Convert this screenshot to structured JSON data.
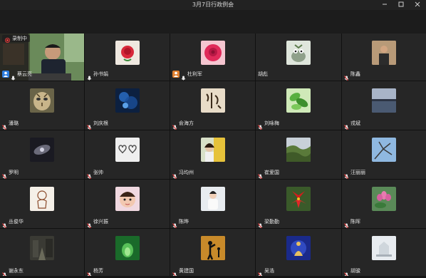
{
  "window": {
    "title": "3月7日行政例会",
    "minimize_icon": "minimize-icon",
    "maximize_icon": "maximize-icon",
    "close_icon": "close-icon"
  },
  "recording": {
    "label": "录制中"
  },
  "participants": [
    {
      "name": "蔡云亮",
      "mic": "on",
      "badge": "host",
      "badge_color": "#2f7fe0",
      "video": true
    },
    {
      "name": "孙书娟",
      "mic": "on",
      "avatar": "red-rose"
    },
    {
      "name": "杜利军",
      "mic": "on",
      "badge": "cohost",
      "badge_color": "#e08030",
      "avatar": "pink-rose"
    },
    {
      "name": "胡彪",
      "mic": "none",
      "avatar": "cartoon-pot"
    },
    {
      "name": "陈鑫",
      "mic": "off",
      "avatar": "man-portrait"
    },
    {
      "name": "潘璐",
      "mic": "off",
      "avatar": "tiger-face"
    },
    {
      "name": "刘庆根",
      "mic": "off",
      "avatar": "blue-water"
    },
    {
      "name": "俞海方",
      "mic": "off",
      "avatar": "calligraphy"
    },
    {
      "name": "刘咏梅",
      "mic": "off",
      "avatar": "green-leaves"
    },
    {
      "name": "戎斌",
      "mic": "off",
      "avatar": "lake-sunset"
    },
    {
      "name": "罗明",
      "mic": "off",
      "avatar": "galaxy"
    },
    {
      "name": "张帅",
      "mic": "off",
      "avatar": "hearts"
    },
    {
      "name": "冯均州",
      "mic": "off",
      "avatar": "woman-flowers"
    },
    {
      "name": "崔爱国",
      "mic": "off",
      "avatar": "valley"
    },
    {
      "name": "汪丽丽",
      "mic": "off",
      "avatar": "branches-sky"
    },
    {
      "name": "丛俊华",
      "mic": "off",
      "avatar": "sketch-figure"
    },
    {
      "name": "徐兴振",
      "mic": "off",
      "avatar": "child-face"
    },
    {
      "name": "陈晔",
      "mic": "off",
      "avatar": "girl-white"
    },
    {
      "name": "梁勤勤",
      "mic": "off",
      "avatar": "red-flower"
    },
    {
      "name": "陈晖",
      "mic": "off",
      "avatar": "pink-lotus"
    },
    {
      "name": "谢永东",
      "mic": "off",
      "avatar": "street"
    },
    {
      "name": "杨芳",
      "mic": "off",
      "avatar": "green-tunnel"
    },
    {
      "name": "黄建国",
      "mic": "off",
      "avatar": "silhouette"
    },
    {
      "name": "吴浩",
      "mic": "off",
      "avatar": "buddha"
    },
    {
      "name": "胡骏",
      "mic": "off",
      "avatar": "white-building"
    }
  ]
}
